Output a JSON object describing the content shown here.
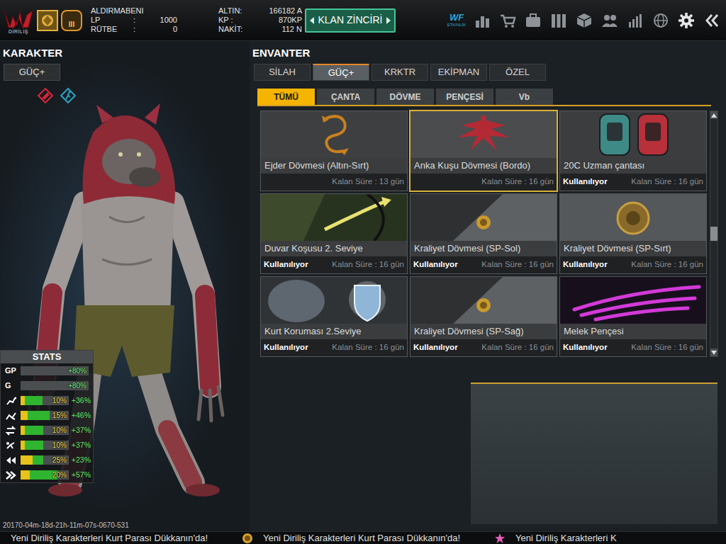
{
  "top_bar": {
    "logo": {
      "text": "DİRİLİŞ"
    },
    "rank_badge": {
      "text": "III"
    },
    "player": {
      "name": "ALDIRMABENI",
      "rows": [
        {
          "label": "LP",
          "sep": ":",
          "value": "1000"
        },
        {
          "label": "RÜTBE",
          "sep": ":",
          "value": "0"
        }
      ]
    },
    "currency": [
      {
        "label": "ALTIN:",
        "value": "166182 A"
      },
      {
        "label": "KP :",
        "value": "870KP"
      },
      {
        "label": "NAKİT:",
        "value": "112 N"
      }
    ],
    "clan_button": {
      "label": "KLAN ZİNCİRİ"
    },
    "event": {
      "logo": "WF",
      "label": "ETKİNLİK"
    }
  },
  "character": {
    "title": "KARAKTER",
    "tab": {
      "label": "GÜÇ+"
    },
    "stats": {
      "title": "STATS",
      "rows": [
        {
          "kind": "plain",
          "label": "GP",
          "value": "+80%"
        },
        {
          "kind": "plain",
          "label": "G",
          "value": "+80%"
        },
        {
          "kind": "bar",
          "value": "10%",
          "bonus": "+36%",
          "level": 0.1,
          "bonus_level": 0.36
        },
        {
          "kind": "bar",
          "value": "15%",
          "bonus": "+46%",
          "level": 0.15,
          "bonus_level": 0.46
        },
        {
          "kind": "bar",
          "value": "10%",
          "bonus": "+37%",
          "level": 0.1,
          "bonus_level": 0.37
        },
        {
          "kind": "bar",
          "value": "10%",
          "bonus": "+37%",
          "level": 0.1,
          "bonus_level": 0.37
        },
        {
          "kind": "bar",
          "value": "25%",
          "bonus": "+23%",
          "level": 0.25,
          "bonus_level": 0.23
        },
        {
          "kind": "bar",
          "value": "20%",
          "bonus": "+57%",
          "level": 0.2,
          "bonus_level": 0.57
        }
      ]
    }
  },
  "inventory": {
    "title": "ENVANTER",
    "tabs": [
      {
        "label": "SİLAH",
        "selected": false
      },
      {
        "label": "GÜÇ+",
        "selected": true
      },
      {
        "label": "KRKTR",
        "selected": false
      },
      {
        "label": "EKİPMAN",
        "selected": false
      },
      {
        "label": "ÖZEL",
        "selected": false
      }
    ],
    "subtabs": [
      {
        "label": "TÜMÜ",
        "selected": true
      },
      {
        "label": "ÇANTA",
        "selected": false
      },
      {
        "label": "DÖVME",
        "selected": false
      },
      {
        "label": "PENÇESİ",
        "selected": false
      },
      {
        "label": "Vb",
        "selected": false
      }
    ],
    "in_use_label": "Kullanılıyor",
    "items": [
      {
        "name": "Ejder Dövmesi (Altın-Sırt)",
        "remaining": "Kalan Süre : 13 gün",
        "in_use": false,
        "selected": false,
        "kind": "dragon"
      },
      {
        "name": "Anka Kuşu Dövmesi (Bordo)",
        "remaining": "Kalan Süre : 16 gün",
        "in_use": false,
        "selected": true,
        "kind": "phoenix"
      },
      {
        "name": "20C Uzman çantası",
        "remaining": "Kalan Süre : 16 gün",
        "in_use": true,
        "selected": false,
        "kind": "bags"
      },
      {
        "name": "Duvar Koşusu 2. Seviye",
        "remaining": "Kalan Süre : 16 gün",
        "in_use": true,
        "selected": false,
        "kind": "wallrun"
      },
      {
        "name": "Kraliyet Dövmesi (SP-Sol)",
        "remaining": "Kalan Süre : 16 gün",
        "in_use": true,
        "selected": false,
        "kind": "emblem"
      },
      {
        "name": "Kraliyet Dövmesi (SP-Sırt)",
        "remaining": "Kalan Süre : 16 gün",
        "in_use": true,
        "selected": false,
        "kind": "crest"
      },
      {
        "name": "Kurt Koruması 2.Seviye",
        "remaining": "Kalan Süre : 16 gün",
        "in_use": true,
        "selected": false,
        "kind": "shield"
      },
      {
        "name": "Kraliyet Dövmesi (SP-Sağ)",
        "remaining": "Kalan Süre : 16 gün",
        "in_use": true,
        "selected": false,
        "kind": "emblem"
      },
      {
        "name": "Melek Pençesi",
        "remaining": "Kalan Süre : 16 gün",
        "in_use": true,
        "selected": false,
        "kind": "claw"
      }
    ],
    "scroll_position": 0.5
  },
  "footer": {
    "timestamp": "20170-04m-18d-21h-11m-07s-0670-531",
    "messages": [
      "Yeni Diriliş Karakterleri Kurt Parası Dükkanın'da!",
      "Yeni Diriliş Karakterleri Kurt Parası Dükkanın'da!",
      "Yeni Diriliş Karakterleri K"
    ]
  }
}
